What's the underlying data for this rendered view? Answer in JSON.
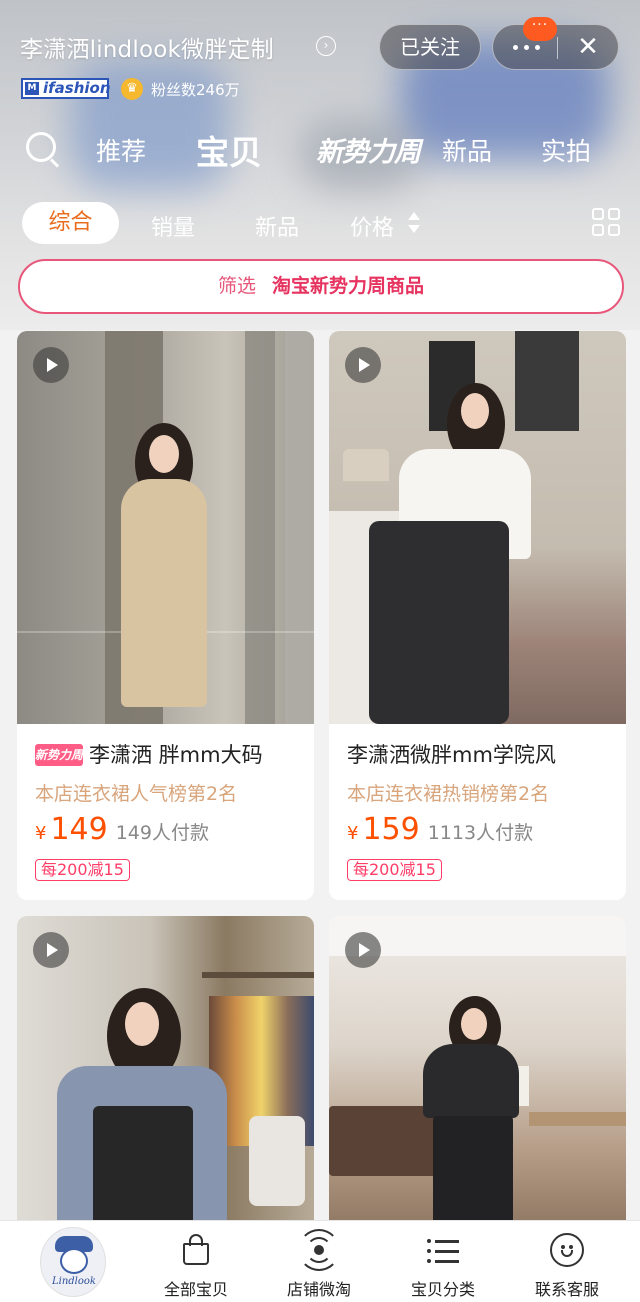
{
  "header": {
    "store_name": "李潇洒lindlook微胖定制",
    "follow_label": "已关注",
    "notify_badge": "···",
    "more_icon": "more-dots-icon",
    "close_icon": "close-icon",
    "badge_label": "ifashion",
    "fans_text": "粉丝数246万"
  },
  "nav": {
    "items": [
      {
        "label": "推荐"
      },
      {
        "label": "宝贝"
      },
      {
        "label": "新势力周"
      },
      {
        "label": "新品"
      },
      {
        "label": "实拍"
      }
    ],
    "active_index": 1
  },
  "sort": {
    "items": [
      {
        "label": "综合"
      },
      {
        "label": "销量"
      },
      {
        "label": "新品"
      },
      {
        "label": "价格"
      }
    ],
    "active_index": 0
  },
  "filter": {
    "label": "筛选",
    "value": "淘宝新势力周商品"
  },
  "products": [
    {
      "tag": "新势力周",
      "title": "李潇洒 胖mm大码",
      "rank": "本店连衣裙人气榜第2名",
      "currency": "¥",
      "price": "149",
      "sold": "149人付款",
      "coupon": "每200减15"
    },
    {
      "title": "李潇洒微胖mm学院风",
      "rank": "本店连衣裙热销榜第2名",
      "currency": "¥",
      "price": "159",
      "sold": "1113人付款",
      "coupon": "每200减15"
    }
  ],
  "tabbar": {
    "logo_text": "Lindlook",
    "tabs": [
      {
        "label": "全部宝贝",
        "icon": "shopping-bag-icon"
      },
      {
        "label": "店铺微淘",
        "icon": "live-broadcast-icon"
      },
      {
        "label": "宝贝分类",
        "icon": "list-icon"
      },
      {
        "label": "联系客服",
        "icon": "chat-smile-icon"
      }
    ]
  },
  "colors": {
    "accent_orange": "#ff5000",
    "sort_active": "#e96c1e",
    "filter_pink": "#e8567a",
    "coupon_red": "#ff3d67",
    "rank_tan": "#d8a57c"
  }
}
